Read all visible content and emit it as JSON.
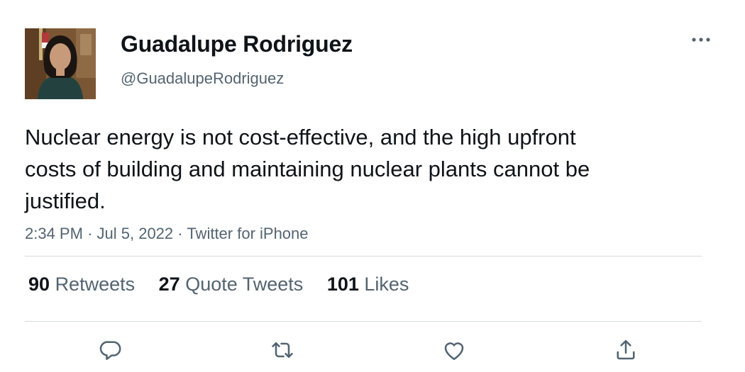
{
  "tweet": {
    "author": {
      "name": "Guadalupe Rodriguez",
      "handle": "@GuadalupeRodriguez"
    },
    "text": "Nuclear energy is not cost-effective, and the high upfront costs of building and maintaining nuclear plants cannot be justified.",
    "time": "2:34 PM",
    "date": "Jul 5, 2022",
    "source": "Twitter for iPhone",
    "separator": "·"
  },
  "stats": {
    "retweets": {
      "count": "90",
      "label": "Retweets"
    },
    "quotes": {
      "count": "27",
      "label": "Quote Tweets"
    },
    "likes": {
      "count": "101",
      "label": "Likes"
    }
  },
  "icons": {
    "more": "more-icon",
    "reply": "reply-icon",
    "retweet": "retweet-icon",
    "like": "heart-icon",
    "share": "share-icon"
  },
  "colors": {
    "text": "#0f1419",
    "secondary": "#536471",
    "divider": "#d6d9db"
  }
}
